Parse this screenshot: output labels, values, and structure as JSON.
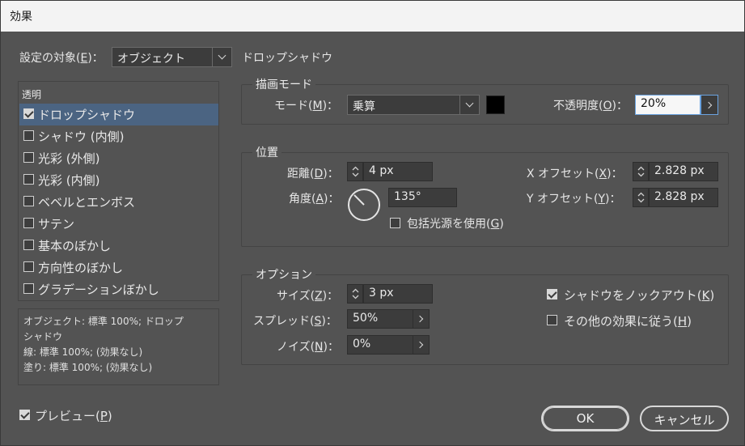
{
  "window": {
    "title": "効果"
  },
  "settings_target": {
    "label": "設定の対象(E)：",
    "label_pre": "設定の対象(",
    "label_key": "E",
    "label_post": ")：",
    "value": "オブジェクト",
    "effect_name": "ドロップシャドウ"
  },
  "sidebar": {
    "header": "透明",
    "items": [
      {
        "label": "ドロップシャドウ",
        "checked": true,
        "selected": true
      },
      {
        "label": "シャドウ (内側)",
        "checked": false,
        "selected": false
      },
      {
        "label": "光彩 (外側)",
        "checked": false,
        "selected": false
      },
      {
        "label": "光彩 (内側)",
        "checked": false,
        "selected": false
      },
      {
        "label": "ベベルとエンボス",
        "checked": false,
        "selected": false
      },
      {
        "label": "サテン",
        "checked": false,
        "selected": false
      },
      {
        "label": "基本のぼかし",
        "checked": false,
        "selected": false
      },
      {
        "label": "方向性のぼかし",
        "checked": false,
        "selected": false
      },
      {
        "label": "グラデーションぼかし",
        "checked": false,
        "selected": false
      }
    ]
  },
  "summary": {
    "line1": "オブジェクト: 標準 100%; ドロップ",
    "line2": "シャドウ",
    "line3": "線: 標準 100%; (効果なし)",
    "line4": "塗り: 標準 100%; (効果なし)"
  },
  "preview": {
    "label_pre": "プレビュー(",
    "label_key": "P",
    "label_post": ")",
    "checked": true
  },
  "blend": {
    "title": "描画モード",
    "mode_label_pre": "モード(",
    "mode_label_key": "M",
    "mode_label_post": ")：",
    "mode_value": "乗算",
    "color": "#000000",
    "opacity_label_pre": "不透明度(",
    "opacity_label_key": "O",
    "opacity_label_post": ")：",
    "opacity_value": "20%"
  },
  "position": {
    "title": "位置",
    "distance_label_pre": "距離(",
    "distance_label_key": "D",
    "distance_label_post": ")：",
    "distance_value": "4 px",
    "angle_label_pre": "角度(",
    "angle_label_key": "A",
    "angle_label_post": ")：",
    "angle_value": "135°",
    "angle_degrees": 135,
    "global_light_pre": "包括光源を使用(",
    "global_light_key": "G",
    "global_light_post": ")",
    "global_light_checked": false,
    "x_offset_label_pre": "X オフセット(",
    "x_offset_label_key": "X",
    "x_offset_label_post": ")：",
    "x_offset_value": "2.828 px",
    "y_offset_label_pre": "Y オフセット(",
    "y_offset_label_key": "Y",
    "y_offset_label_post": ")：",
    "y_offset_value": "2.828 px"
  },
  "options": {
    "title": "オプション",
    "size_label_pre": "サイズ(",
    "size_label_key": "Z",
    "size_label_post": ")：",
    "size_value": "3 px",
    "spread_label_pre": "スプレッド(",
    "spread_label_key": "S",
    "spread_label_post": ")：",
    "spread_value": "50%",
    "noise_label_pre": "ノイズ(",
    "noise_label_key": "N",
    "noise_label_post": ")：",
    "noise_value": "0%",
    "knockout_pre": "シャドウをノックアウト(",
    "knockout_key": "K",
    "knockout_post": ")",
    "knockout_checked": true,
    "honor_pre": "その他の効果に従う(",
    "honor_key": "H",
    "honor_post": ")",
    "honor_checked": false
  },
  "buttons": {
    "ok": "OK",
    "cancel": "キャンセル"
  }
}
